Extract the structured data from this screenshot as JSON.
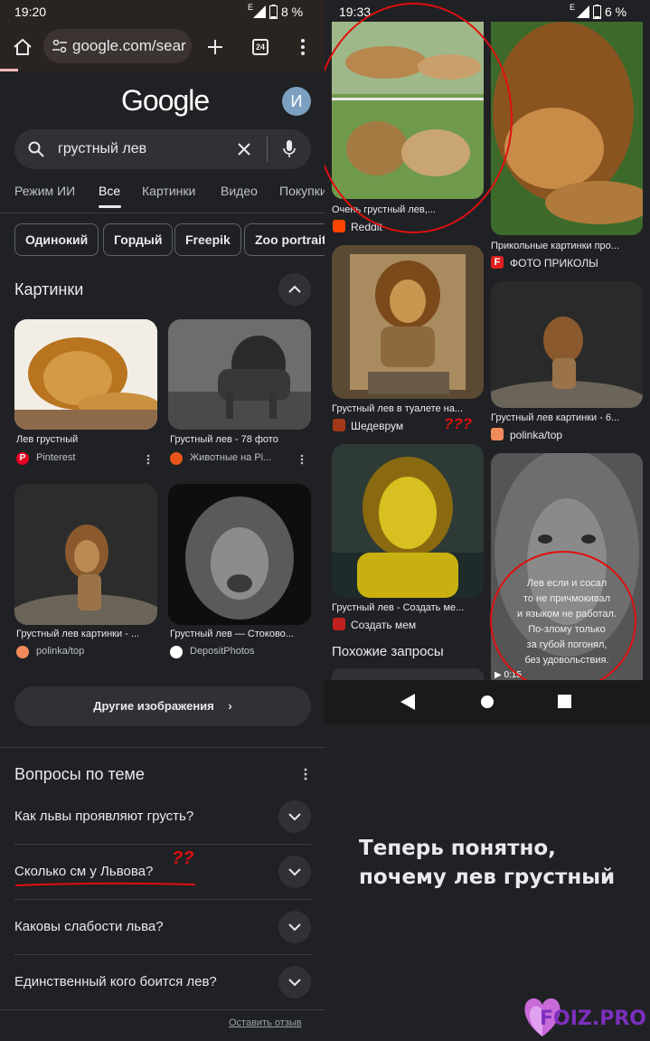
{
  "left": {
    "status": {
      "time": "19:20",
      "signal": "E",
      "battery": "8 %"
    },
    "browser": {
      "url": "google.com/sear",
      "tab_count": "24"
    },
    "google": {
      "logo": "Google",
      "avatar_letter": "И"
    },
    "search": {
      "query": "грустный лев"
    },
    "tabs": [
      {
        "label": "Режим ИИ"
      },
      {
        "label": "Все"
      },
      {
        "label": "Картинки"
      },
      {
        "label": "Видео"
      },
      {
        "label": "Покупки"
      }
    ],
    "chips": [
      {
        "label": "Одинокий"
      },
      {
        "label": "Гордый"
      },
      {
        "label": "Freepik"
      },
      {
        "label": "Zoo portrait"
      }
    ],
    "images_section": {
      "title": "Картинки",
      "items": [
        {
          "caption": "Лев грустный",
          "source": "Pinterest",
          "icon": "pinterest-icon"
        },
        {
          "caption": "Грустный лев - 78 фото",
          "source": "Животные на Pi...",
          "icon": "site-icon"
        },
        {
          "caption": "Грустный лев картинки - ...",
          "source": "polinka/top",
          "icon": "polinka-icon"
        },
        {
          "caption": "Грустный лев — Стоково...",
          "source": "DepositPhotos",
          "icon": "depositphotos-icon"
        }
      ],
      "more_button": "Другие изображения"
    },
    "questions": {
      "title": "Вопросы по теме",
      "items": [
        {
          "text": "Как львы проявляют грусть?"
        },
        {
          "text": "Сколько см у Львова?"
        },
        {
          "text": "Каковы слабости льва?"
        },
        {
          "text": "Единственный кого боится лев?"
        }
      ],
      "feedback": "Оставить отзыв",
      "annotation": "??"
    }
  },
  "right": {
    "status": {
      "time": "19:33",
      "signal": "E",
      "battery": "6 %"
    },
    "items": [
      {
        "caption": "Очень грустный лев,...",
        "source": "Reddit"
      },
      {
        "caption": "Прикольные картинки про...",
        "source": "ФОТО ПРИКОЛЫ"
      },
      {
        "caption": "Грустный лев в туалете на...",
        "source": "Шедеврум"
      },
      {
        "caption": "Грустный лев картинки - 6...",
        "source": "polinka/top"
      },
      {
        "caption": "Грустный лев - Создать ме...",
        "source": "Создать мем"
      }
    ],
    "related": "Похожие запросы",
    "annotation": "???",
    "quote": [
      "Лев если и сосал",
      "то не причмокивал",
      "и языком не работал.",
      "По-злому только",
      "за губой погонял,",
      "без удовольствия."
    ],
    "video_time": "0:15"
  },
  "caption_text": "Теперь понятно, почему лев грустный",
  "watermark": "FOIZ.PRO",
  "colors": {
    "annotation": "#e01010",
    "background": "#202124"
  }
}
